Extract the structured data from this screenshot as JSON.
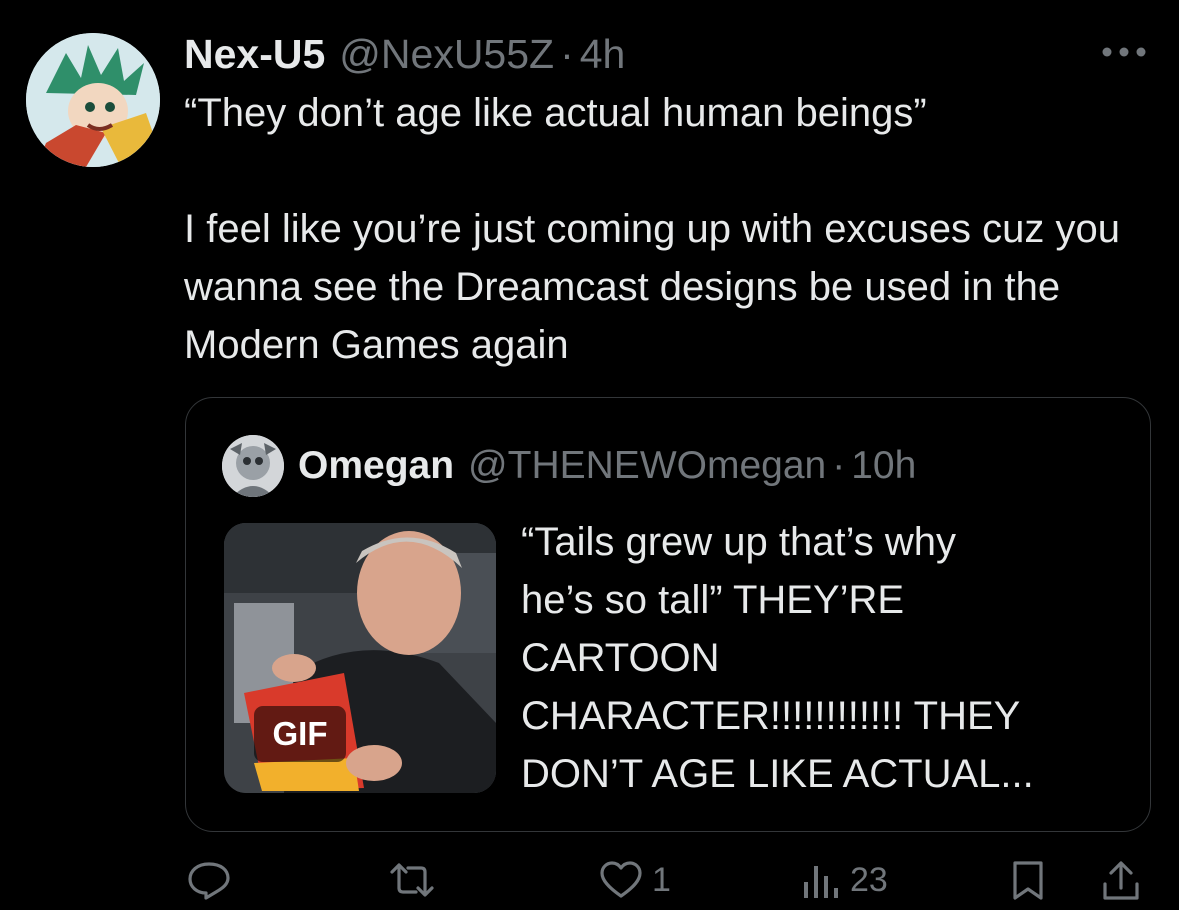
{
  "tweet": {
    "author_name": "Nex-U5",
    "author_handle": "@NexU55Z",
    "dot": "·",
    "timestamp": "4h",
    "more_icon": "more-horizontal-icon",
    "text_line1": "“They don’t age like actual human beings”",
    "text_para2": "I feel like you’re just coming up with excuses cuz you wanna see the Dreamcast designs be used in the Modern Games again"
  },
  "quote": {
    "author_name": "Omegan",
    "author_handle": "@THENEWOmegan",
    "dot": "·",
    "timestamp": "10h",
    "gif_label": "GIF",
    "text": "“Tails grew up that’s why\nhe’s so tall” THEY’RE\nCARTOON\nCHARACTER!!!!!!!!!!!! THEY\nDON’T AGE LIKE ACTUAL..."
  },
  "actions": {
    "reply_icon": "reply-icon",
    "retweet_icon": "retweet-icon",
    "like_icon": "heart-icon",
    "like_count": "1",
    "views_icon": "analytics-icon",
    "views_count": "23",
    "bookmark_icon": "bookmark-icon",
    "share_icon": "share-icon"
  },
  "colors": {
    "background": "#000000",
    "primary_text": "#e7e9ea",
    "secondary_text": "#71767b",
    "border": "#333639"
  }
}
